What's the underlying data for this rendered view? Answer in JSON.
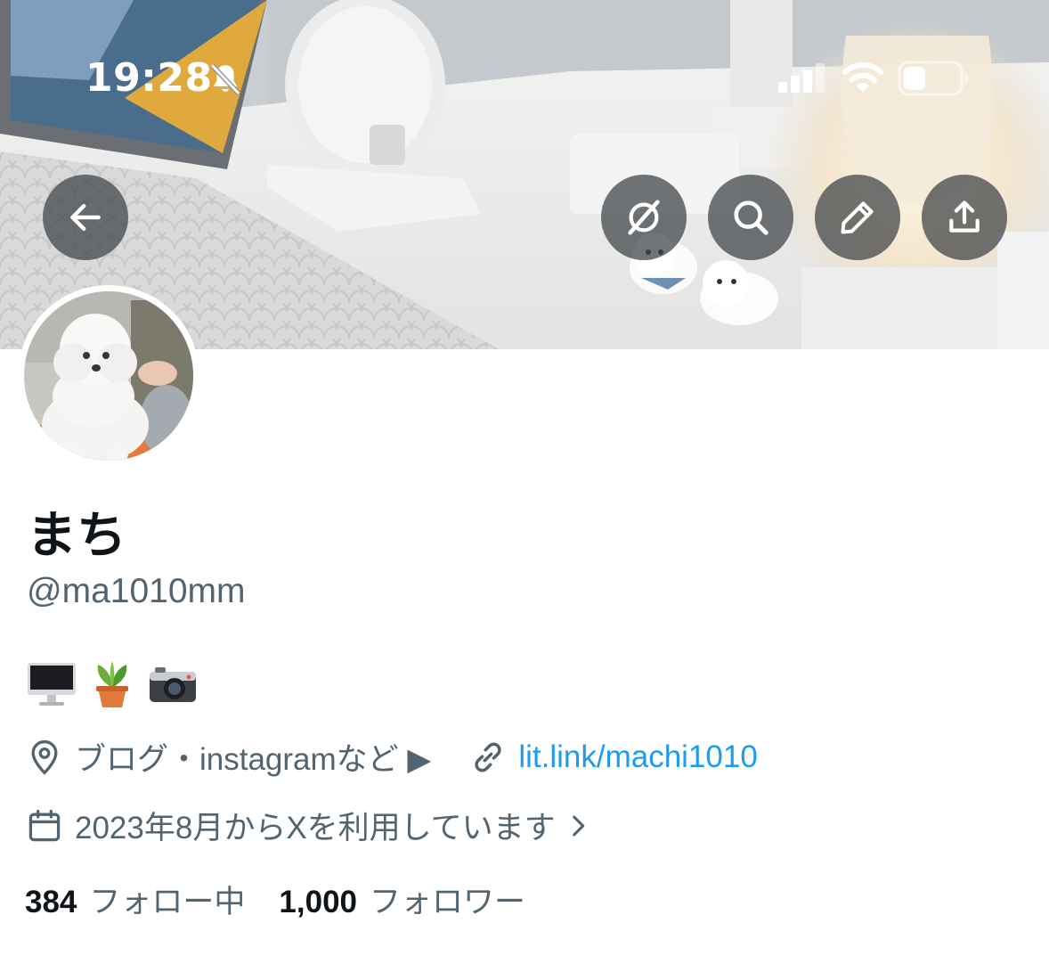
{
  "status_bar": {
    "time": "19:28",
    "icons": [
      "bell-slash-icon",
      "signal-icon",
      "wifi-icon",
      "battery-icon"
    ]
  },
  "header": {
    "buttons": [
      "back-arrow-icon",
      "grok-icon",
      "search-icon",
      "edit-pencil-icon",
      "share-icon"
    ]
  },
  "profile": {
    "display_name": "まち",
    "handle": "@ma1010mm",
    "bio_emojis": [
      "desktop-computer-icon",
      "potted-plant-icon",
      "camera-icon"
    ],
    "location": "ブログ・instagramなど ▶︎",
    "link": "lit.link/machi1010",
    "joined": "2023年8月からXを利用しています"
  },
  "stats": {
    "following_count": "384",
    "following_label": "フォロー中",
    "followers_count": "1,000",
    "followers_label": "フォロワー"
  },
  "colors": {
    "text_primary": "#0f1419",
    "text_secondary": "#536471",
    "link": "#1d9bf0",
    "button_overlay": "#3c4044"
  }
}
